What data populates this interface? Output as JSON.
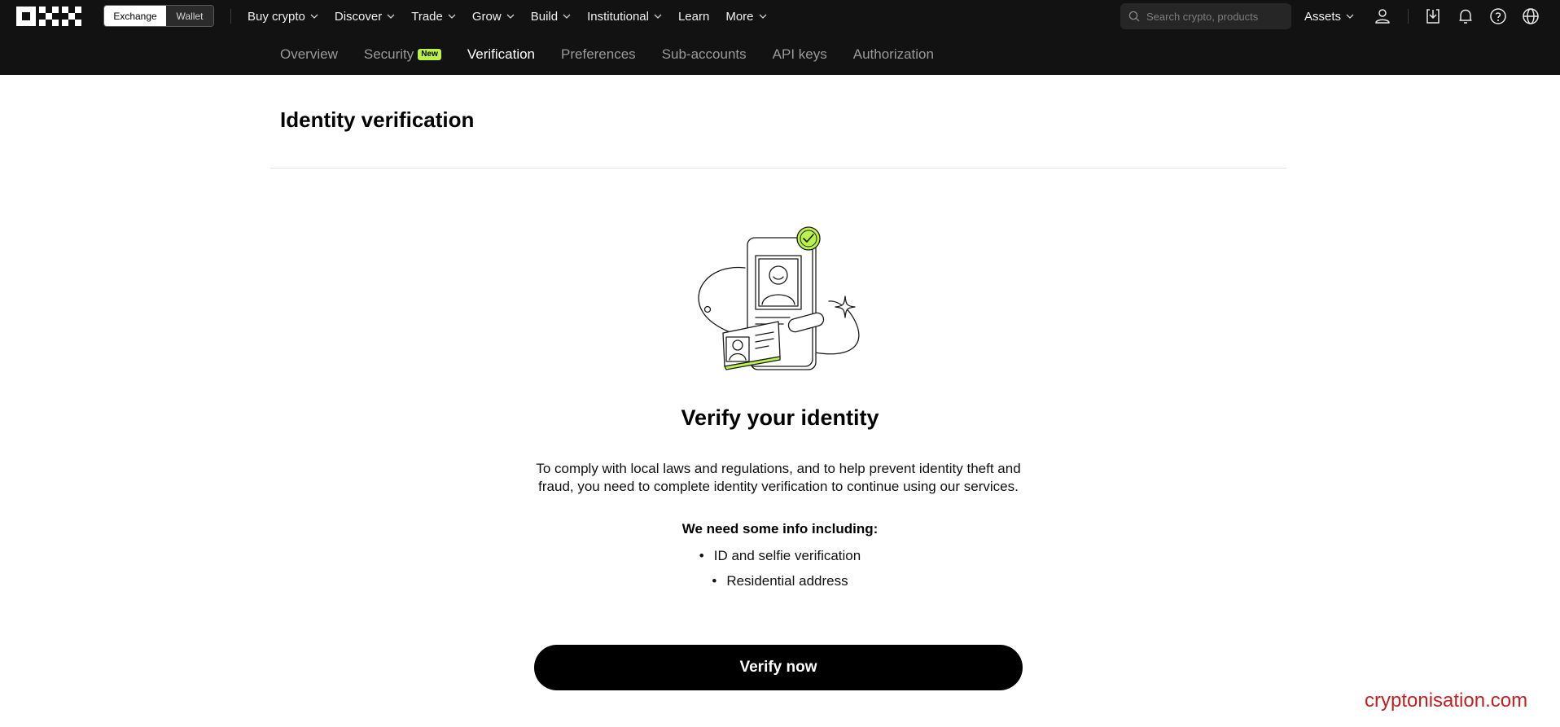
{
  "topbar": {
    "mode_tabs": [
      {
        "label": "Exchange",
        "active": true
      },
      {
        "label": "Wallet",
        "active": false
      }
    ],
    "nav": [
      {
        "label": "Buy crypto",
        "dropdown": true
      },
      {
        "label": "Discover",
        "dropdown": true
      },
      {
        "label": "Trade",
        "dropdown": true
      },
      {
        "label": "Grow",
        "dropdown": true
      },
      {
        "label": "Build",
        "dropdown": true
      },
      {
        "label": "Institutional",
        "dropdown": true
      },
      {
        "label": "Learn",
        "dropdown": false
      },
      {
        "label": "More",
        "dropdown": true
      }
    ],
    "search_placeholder": "Search crypto, products",
    "assets_label": "Assets",
    "icons": [
      "user-icon",
      "download-icon",
      "bell-icon",
      "help-icon",
      "globe-icon"
    ]
  },
  "subnav": {
    "items": [
      {
        "label": "Overview",
        "active": false
      },
      {
        "label": "Security",
        "active": false,
        "badge": "New"
      },
      {
        "label": "Verification",
        "active": true
      },
      {
        "label": "Preferences",
        "active": false
      },
      {
        "label": "Sub-accounts",
        "active": false
      },
      {
        "label": "API keys",
        "active": false
      },
      {
        "label": "Authorization",
        "active": false
      }
    ]
  },
  "main": {
    "page_title": "Identity verification",
    "hero_title": "Verify your identity",
    "description": "To comply with local laws and regulations, and to help prevent identity theft and fraud, you need to complete identity verification to continue using our services.",
    "info_heading": "We need some info including:",
    "requirements": [
      "ID and selfie verification",
      "Residential address"
    ],
    "button_label": "Verify now"
  },
  "watermark": "cryptonisation.com",
  "colors": {
    "topbar_bg": "#121212",
    "accent_green": "#baf24a",
    "button_bg": "#000000",
    "watermark": "#c41e1e"
  }
}
